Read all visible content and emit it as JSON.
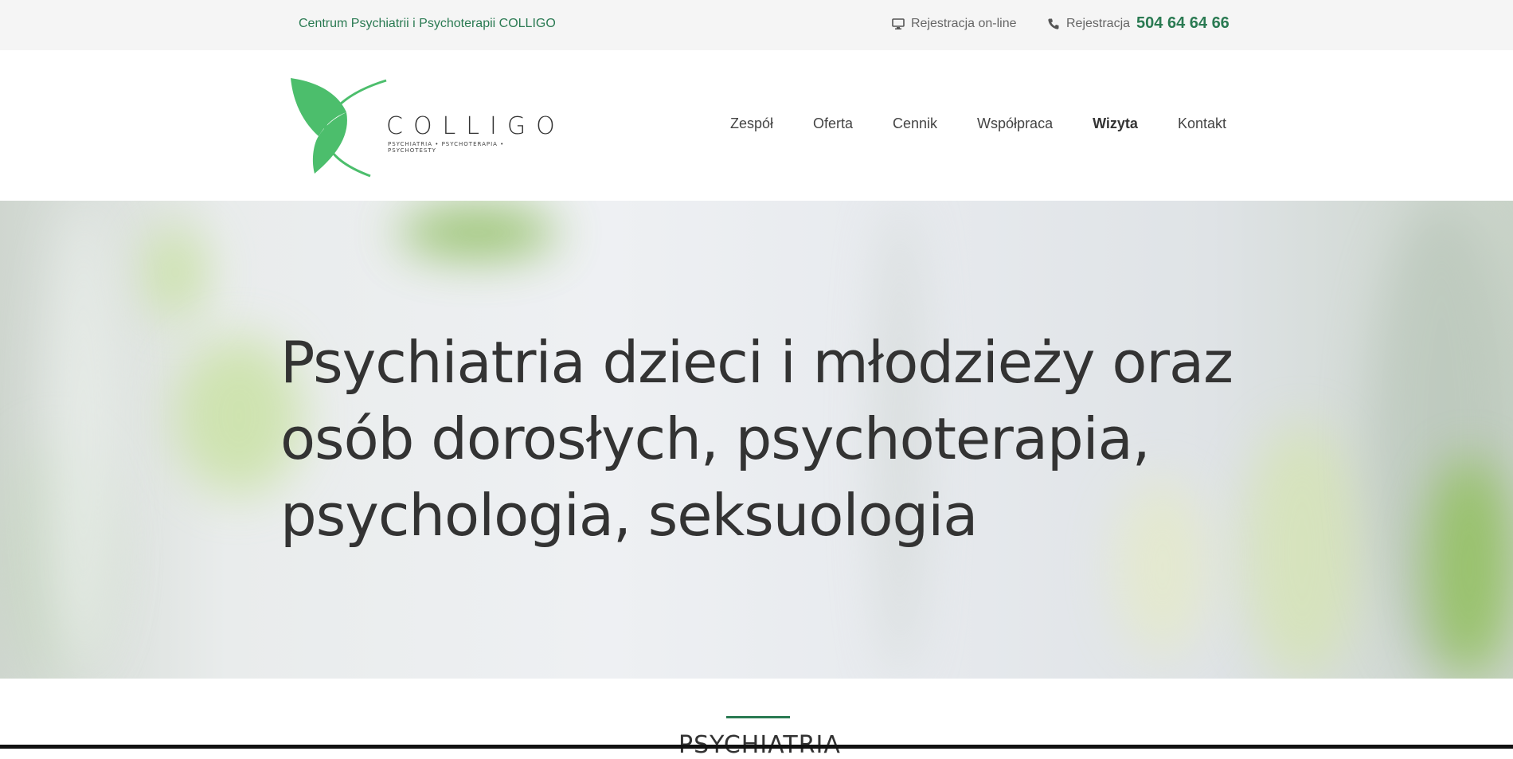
{
  "topbar": {
    "brand": "Centrum Psychiatrii i Psychoterapii COLLIGO",
    "online_registration": "Rejestracja on-line",
    "phone_label": "Rejestracja",
    "phone_number": "504 64 64 66"
  },
  "logo": {
    "wordmark": "COLLIGO",
    "tagline": "PSYCHIATRIA • PSYCHOTERAPIA • PSYCHOTESTY"
  },
  "nav": {
    "items": [
      {
        "label": "Zespół"
      },
      {
        "label": "Oferta"
      },
      {
        "label": "Cennik"
      },
      {
        "label": "Współpraca"
      },
      {
        "label": "Wizyta"
      },
      {
        "label": "Kontakt"
      }
    ]
  },
  "hero": {
    "headline": "Psychiatria dzieci i młodzieży oraz osób dorosłych, psychoterapia, psychologia, seksuologia"
  },
  "section": {
    "title": "PSYCHIATRIA"
  },
  "colors": {
    "accent": "#2a7a52",
    "logo_green": "#4cbe6c"
  },
  "icons": {
    "online_registration": "monitor-icon",
    "phone": "phone-icon"
  }
}
